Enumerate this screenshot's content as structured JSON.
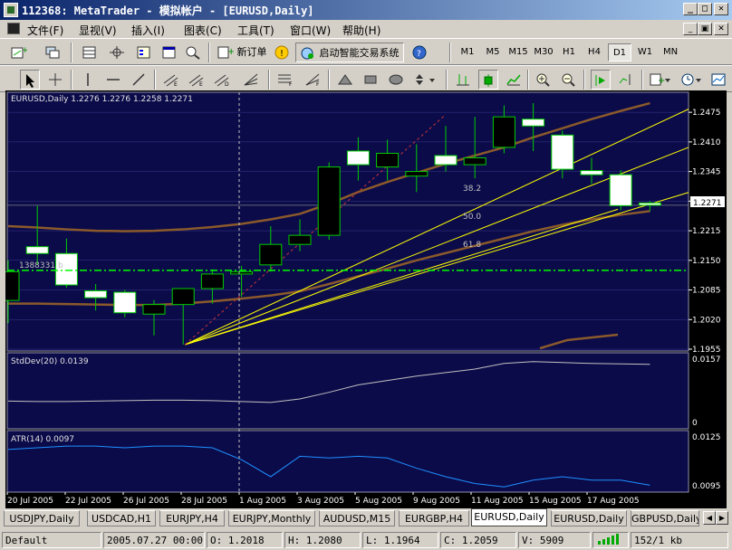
{
  "window": {
    "title": "112368: MetaTrader - 模拟帐户 - [EURUSD,Daily]",
    "controls": [
      "_",
      "□",
      "✕"
    ]
  },
  "menu": {
    "items": [
      "文件(F)",
      "显视(V)",
      "插入(I)",
      "图表(C)",
      "工具(T)",
      "窗口(W)",
      "帮助(H)"
    ],
    "mdi_controls": [
      "_",
      "▣",
      "✕"
    ]
  },
  "toolbar1": {
    "new_order_label": "新订单",
    "expert_label": "启动智能交易系统",
    "timeframes": [
      "M1",
      "M5",
      "M15",
      "M30",
      "H1",
      "H4",
      "D1",
      "W1",
      "MN"
    ],
    "active_timeframe": "D1"
  },
  "toolbar2": {
    "tools": [
      "cursor-icon",
      "crosshair-icon",
      "vertical-line-icon",
      "trendline-icon",
      "channel-icon",
      "fibo-icon",
      "gann-fan-icon",
      "fibo-fan-icon",
      "triangle-icon",
      "rectangle-icon",
      "arrows-icon",
      "bar-chart-icon",
      "candle-chart-icon",
      "line-chart-icon",
      "zoom-in-icon",
      "zoom-out-icon",
      "autoscroll-icon",
      "shift-chart-icon",
      "indicators-icon",
      "periods-icon",
      "templates-icon"
    ]
  },
  "main_chart": {
    "header": "EURUSD,Daily  1.2276 1.2276 1.2258 1.2271",
    "fib_labels": [
      "38.2",
      "50.0",
      "61.8"
    ],
    "order_label": "1388331 b",
    "current_price": "1.2271",
    "price_ticks": [
      "1.2475",
      "1.2410",
      "1.2345",
      "1.2280",
      "1.2215",
      "1.2150",
      "1.2085",
      "1.2020",
      "1.1955"
    ]
  },
  "stddev_panel": {
    "header": "StdDev(20) 0.0139",
    "ticks": [
      "0.0157",
      "0"
    ]
  },
  "atr_panel": {
    "header": "ATR(14) 0.0097",
    "ticks": [
      "0.0125",
      "0.0095"
    ]
  },
  "time_axis": [
    "20 Jul 2005",
    "22 Jul 2005",
    "26 Jul 2005",
    "28 Jul 2005",
    "1 Aug 2005",
    "3 Aug 2005",
    "5 Aug 2005",
    "9 Aug 2005",
    "11 Aug 2005",
    "15 Aug 2005",
    "17 Aug 2005"
  ],
  "colors": {
    "background": "#0b0b4a",
    "grid": "#3a3a8a",
    "bull": "#000000",
    "bear": "#ffffff",
    "candle_outline": "#00cc00",
    "ma": "#8b5a2b",
    "fan": "#ffff00",
    "order_line": "#00ff00",
    "indicator": "#c0c0c0",
    "atr_line": "#1e90ff"
  },
  "chart_data": {
    "type": "candlestick",
    "title": "EURUSD,Daily",
    "dates": [
      "2005-07-19",
      "2005-07-20",
      "2005-07-21",
      "2005-07-22",
      "2005-07-25",
      "2005-07-26",
      "2005-07-27",
      "2005-07-28",
      "2005-07-29",
      "2005-08-01",
      "2005-08-02",
      "2005-08-03",
      "2005-08-04",
      "2005-08-05",
      "2005-08-08",
      "2005-08-09",
      "2005-08-10",
      "2005-08-11",
      "2005-08-12",
      "2005-08-15",
      "2005-08-16",
      "2005-08-17",
      "2005-08-18"
    ],
    "open": [
      1.2062,
      1.218,
      1.2165,
      1.2083,
      1.208,
      1.2032,
      1.2053,
      1.2088,
      1.212,
      1.214,
      1.2185,
      1.2205,
      1.239,
      1.2355,
      1.2335,
      1.238,
      1.236,
      1.2398,
      1.246,
      1.2425,
      1.2347,
      1.2338,
      1.2276
    ],
    "high": [
      1.215,
      1.227,
      1.2198,
      1.2098,
      1.2085,
      1.2063,
      1.2075,
      1.213,
      1.2138,
      1.2225,
      1.224,
      1.2365,
      1.242,
      1.2415,
      1.2405,
      1.2445,
      1.2465,
      1.249,
      1.2495,
      1.2435,
      1.2375,
      1.2348,
      1.228
    ],
    "low": [
      1.2012,
      1.214,
      1.209,
      1.204,
      1.2025,
      1.1985,
      1.1965,
      1.2055,
      1.207,
      1.2125,
      1.217,
      1.2195,
      1.2325,
      1.2325,
      1.23,
      1.2345,
      1.233,
      1.2385,
      1.239,
      1.233,
      1.2318,
      1.226,
      1.2258
    ],
    "close": [
      1.2125,
      1.2165,
      1.2096,
      1.2068,
      1.2035,
      1.2053,
      1.2088,
      1.212,
      1.2125,
      1.2185,
      1.2205,
      1.2355,
      1.236,
      1.2385,
      1.2345,
      1.236,
      1.2375,
      1.2465,
      1.2445,
      1.235,
      1.2338,
      1.227,
      1.2271
    ],
    "ylim": [
      1.1955,
      1.2515
    ],
    "ma_upper": [
      1.2225,
      1.2222,
      1.2218,
      1.2215,
      1.2214,
      1.2215,
      1.2218,
      1.2223,
      1.223,
      1.224,
      1.2252,
      1.2274,
      1.23,
      1.2322,
      1.2342,
      1.2362,
      1.238,
      1.2398,
      1.242,
      1.244,
      1.246,
      1.2478,
      1.2495
    ],
    "ma_lower": [
      1.2055,
      1.2055,
      1.2054,
      1.2053,
      1.2052,
      1.2052,
      1.2055,
      1.206,
      1.2066,
      1.2073,
      1.2082,
      1.2098,
      1.2115,
      1.2132,
      1.215,
      1.2166,
      1.2182,
      1.2198,
      1.2214,
      1.2228,
      1.224,
      1.225,
      1.2258
    ],
    "order_price": 1.2128,
    "stddev": [
      0.0055,
      0.0054,
      0.0054,
      0.0055,
      0.0056,
      0.0057,
      0.0057,
      0.0056,
      0.0054,
      0.0052,
      0.006,
      0.0075,
      0.0092,
      0.0102,
      0.0112,
      0.012,
      0.0128,
      0.0141,
      0.0145,
      0.0143,
      0.0141,
      0.014,
      0.0139
    ],
    "stddev_ylim": [
      0,
      0.0157
    ],
    "atr": [
      0.0118,
      0.0119,
      0.012,
      0.012,
      0.0119,
      0.012,
      0.012,
      0.0119,
      0.0112,
      0.0102,
      0.0114,
      0.0113,
      0.0114,
      0.0113,
      0.0107,
      0.0102,
      0.0098,
      0.0096,
      0.01,
      0.0102,
      0.01,
      0.01,
      0.0097
    ],
    "atr_ylim": [
      0.0094,
      0.0127
    ]
  },
  "tabs": {
    "items": [
      "USDJPY,Daily",
      "USDCAD,H1",
      "EURJPY,H4",
      "EURJPY,Monthly",
      "AUDUSD,M15",
      "EURGBP,H4",
      "EURUSD,Daily",
      "EURUSD,Daily",
      "GBPUSD,Daily"
    ],
    "active_index": 6
  },
  "statusbar": {
    "profile": "Default",
    "datetime": "2005.07.27 00:00",
    "open": "O: 1.2018",
    "high": "H: 1.2080",
    "low": "L: 1.1964",
    "close": "C: 1.2059",
    "volume": "V: 5909",
    "traffic": "152/1 kb"
  }
}
